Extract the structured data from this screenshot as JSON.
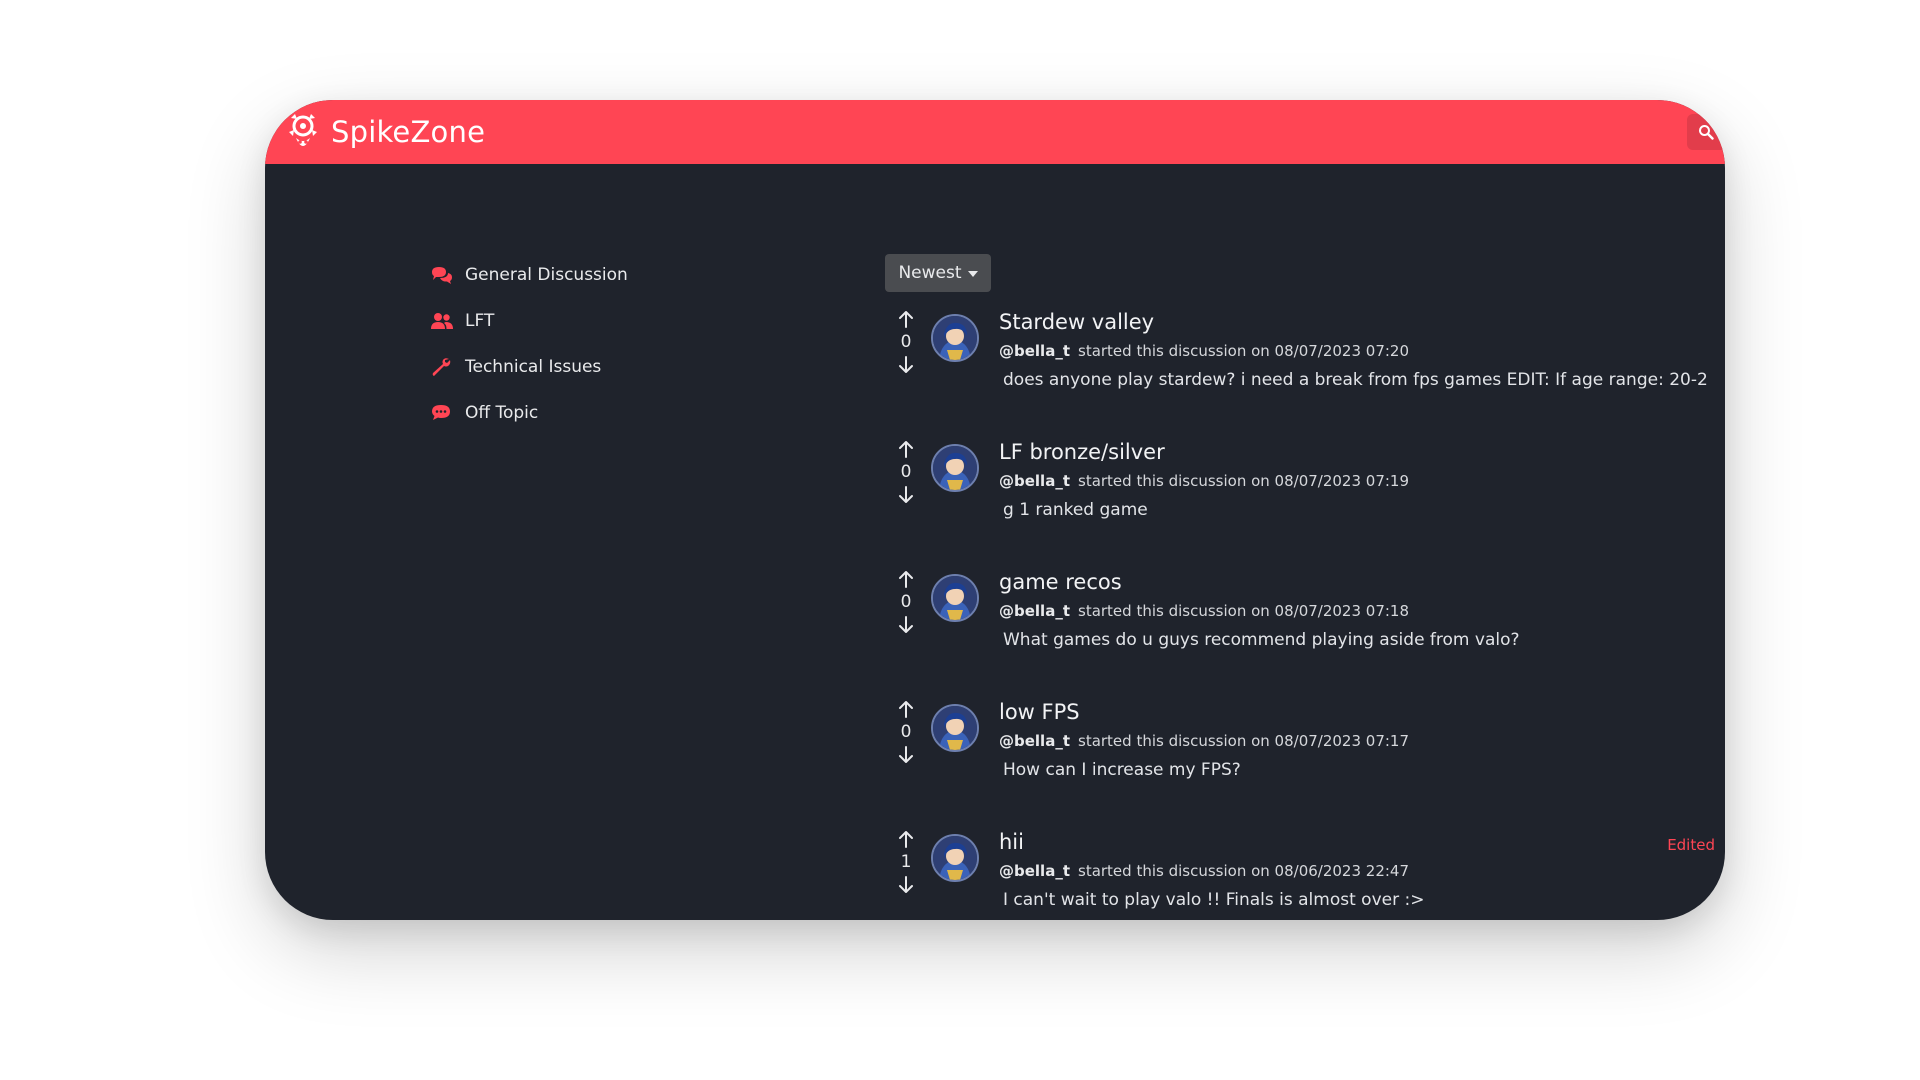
{
  "app": {
    "name": "SpikeZone",
    "accent": "#ff4554",
    "background": "#1f232c"
  },
  "header": {
    "logo_icon": "spike-logo-icon",
    "search_icon": "search-icon"
  },
  "sidebar": {
    "items": [
      {
        "label": "General Discussion",
        "icon": "chat-bubbles-icon"
      },
      {
        "label": "LFT",
        "icon": "users-icon"
      },
      {
        "label": "Technical Issues",
        "icon": "wrench-icon"
      },
      {
        "label": "Off Topic",
        "icon": "comment-dots-icon"
      }
    ]
  },
  "sort": {
    "selected": "Newest"
  },
  "posts": [
    {
      "votes": "0",
      "title": "Stardew valley",
      "author": "@bella_t",
      "meta": "started this discussion on 08/07/2023 07:20",
      "body": "does anyone play stardew? i need a break from fps games EDIT: If age range: 20-2"
    },
    {
      "votes": "0",
      "title": "LF bronze/silver",
      "author": "@bella_t",
      "meta": "started this discussion on 08/07/2023 07:19",
      "body": "g 1 ranked game"
    },
    {
      "votes": "0",
      "title": "game recos",
      "author": "@bella_t",
      "meta": "started this discussion on 08/07/2023 07:18",
      "body": "What games do u guys recommend playing aside from valo?"
    },
    {
      "votes": "0",
      "title": "low FPS",
      "author": "@bella_t",
      "meta": "started this discussion on 08/07/2023 07:17",
      "body": "How can I increase my FPS?"
    },
    {
      "votes": "1",
      "title": "hii",
      "author": "@bella_t",
      "meta": "started this discussion on 08/06/2023 22:47",
      "body": "I can't wait to play valo !! Finals is almost over :>",
      "edited": "Edited"
    }
  ]
}
